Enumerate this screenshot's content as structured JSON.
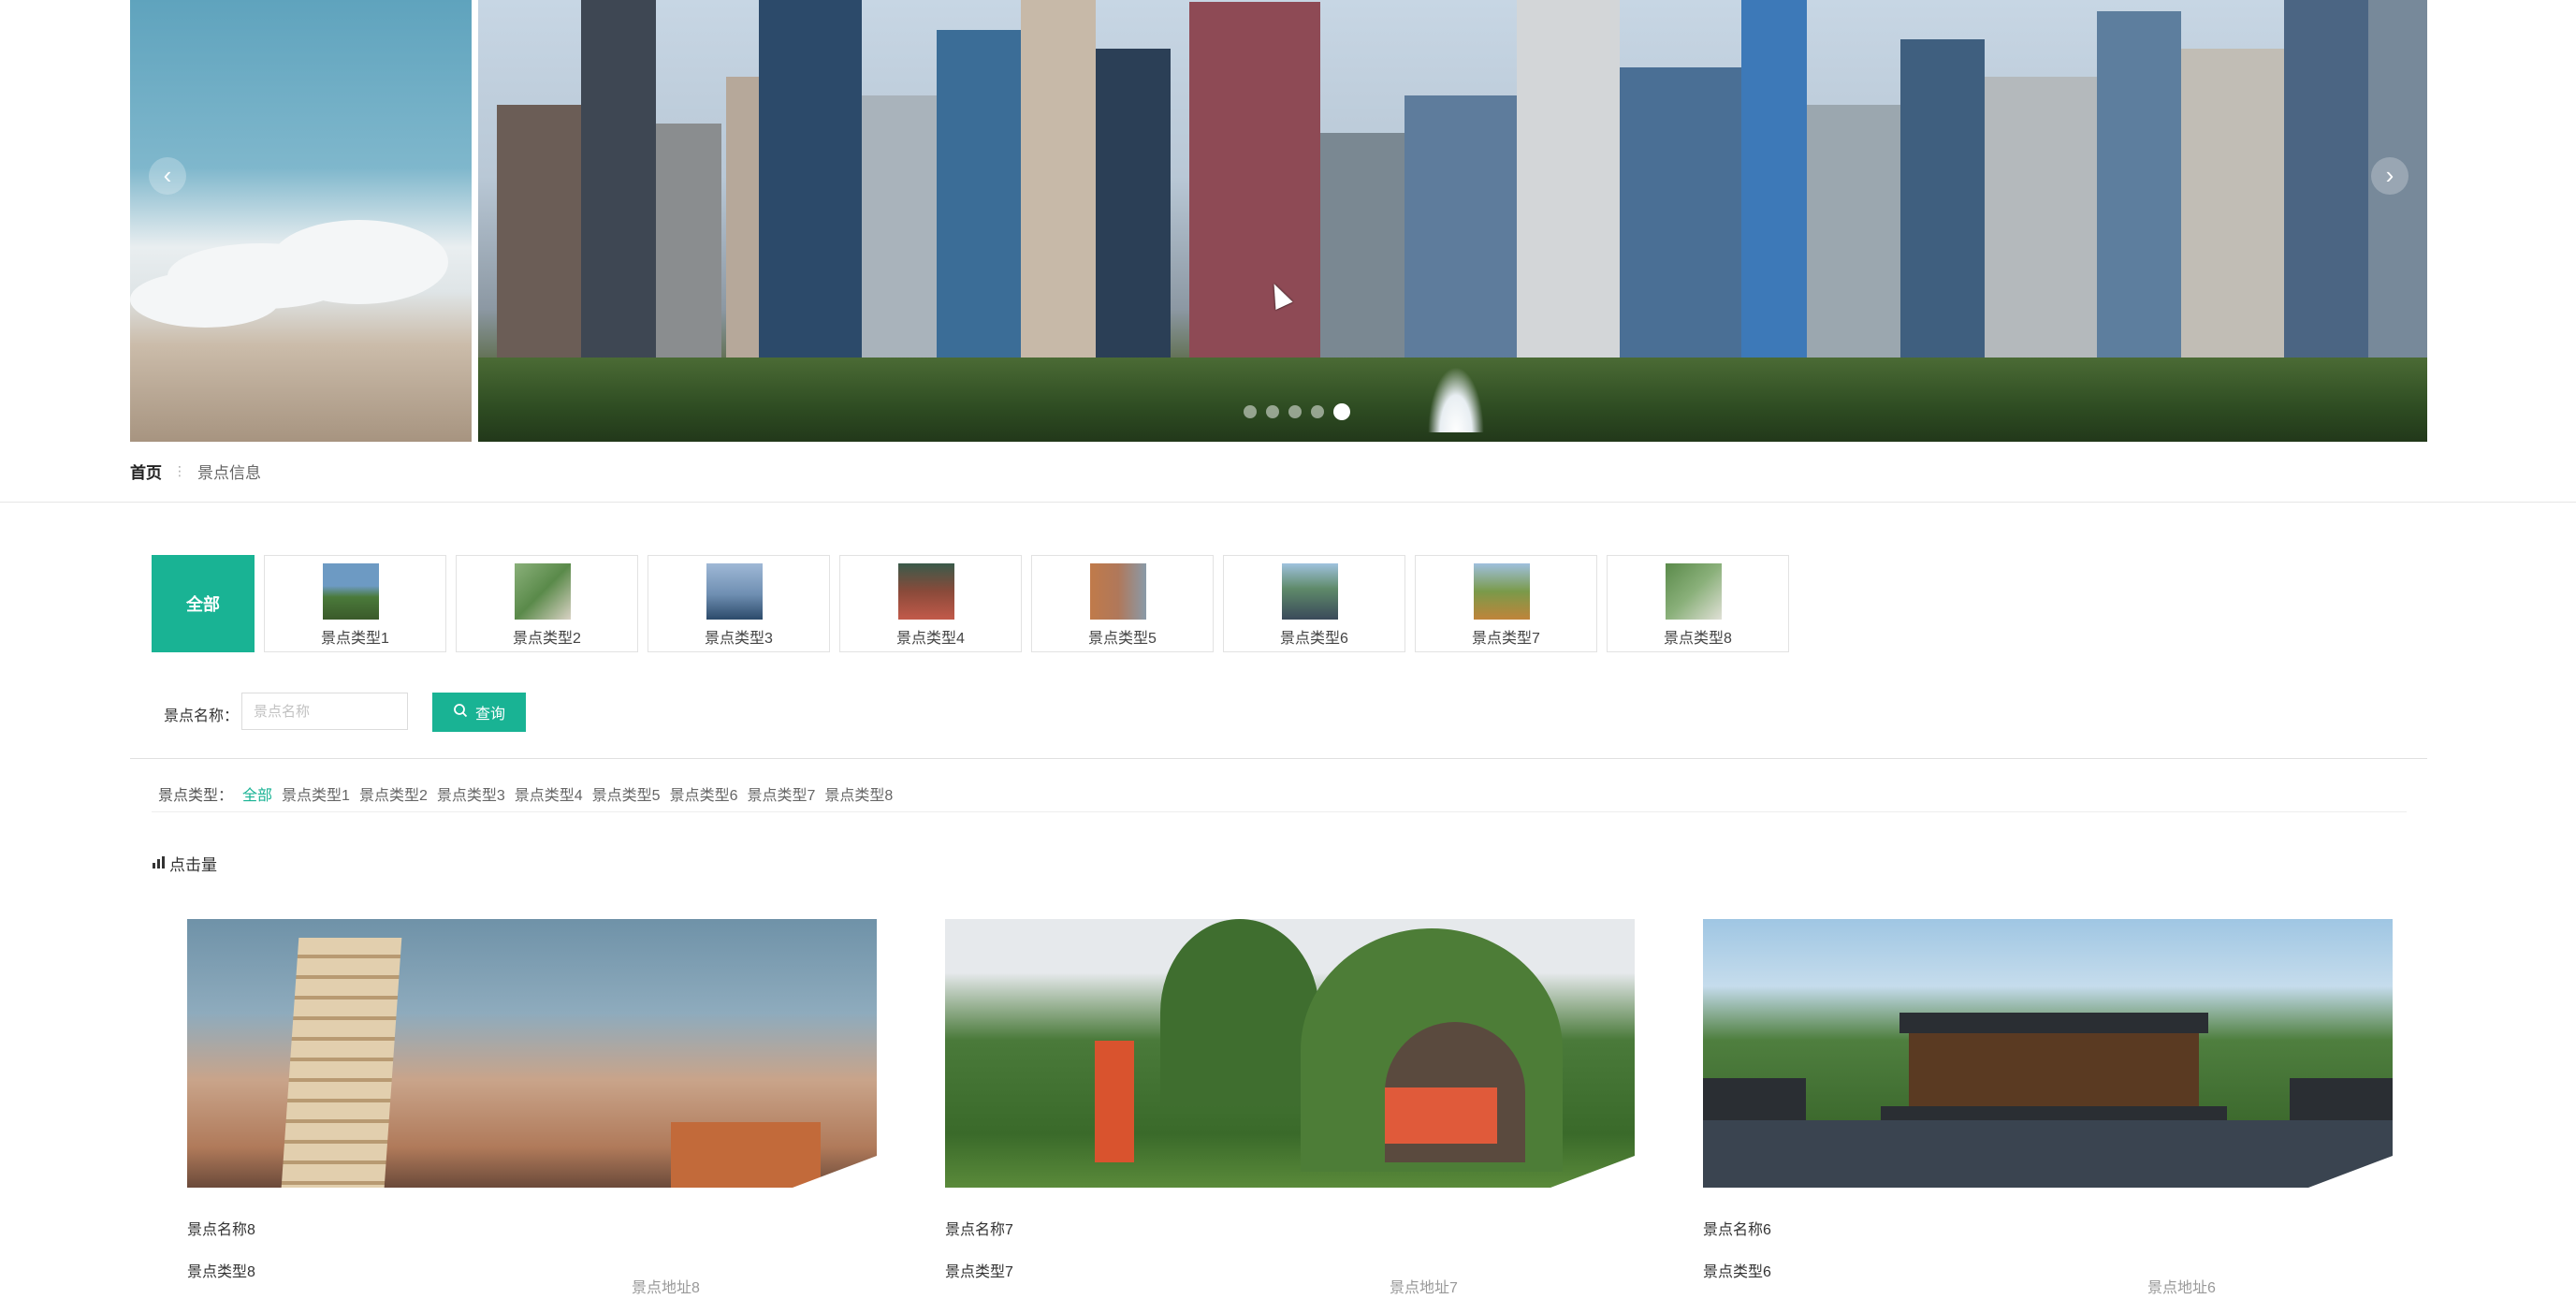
{
  "carousel": {
    "prev_label": "‹",
    "next_label": "›",
    "slide_count": 5,
    "active_index": 4
  },
  "breadcrumb": {
    "home": "首页",
    "separator": "⋮",
    "current": "景点信息"
  },
  "types": {
    "all_label": "全部",
    "items": [
      {
        "label": "景点类型1",
        "color": "#4a7a3a"
      },
      {
        "label": "景点类型2",
        "color": "#6a9a5a"
      },
      {
        "label": "景点类型3",
        "color": "#6f8fb2"
      },
      {
        "label": "景点类型4",
        "color": "#8a4a3a"
      },
      {
        "label": "景点类型5",
        "color": "#b0785a"
      },
      {
        "label": "景点类型6",
        "color": "#5f8a6a"
      },
      {
        "label": "景点类型7",
        "color": "#7a9a4a"
      },
      {
        "label": "景点类型8",
        "color": "#5a8a4a"
      }
    ]
  },
  "search": {
    "label": "景点名称：",
    "placeholder": "景点名称",
    "value": "",
    "button_label": "查询",
    "button_icon": "search-icon"
  },
  "filter": {
    "label": "景点类型：",
    "items": [
      "全部",
      "景点类型1",
      "景点类型2",
      "景点类型3",
      "景点类型4",
      "景点类型5",
      "景点类型6",
      "景点类型7",
      "景点类型8"
    ],
    "active": "全部"
  },
  "sort": {
    "icon": "bar-chart-icon",
    "label": "点击量"
  },
  "cards": [
    {
      "name": "景点名称8",
      "type": "景点类型8",
      "address": "景点地址8"
    },
    {
      "name": "景点名称7",
      "type": "景点类型7",
      "address": "景点地址7"
    },
    {
      "name": "景点名称6",
      "type": "景点类型6",
      "address": "景点地址6"
    }
  ],
  "colors": {
    "accent": "#19b394"
  }
}
